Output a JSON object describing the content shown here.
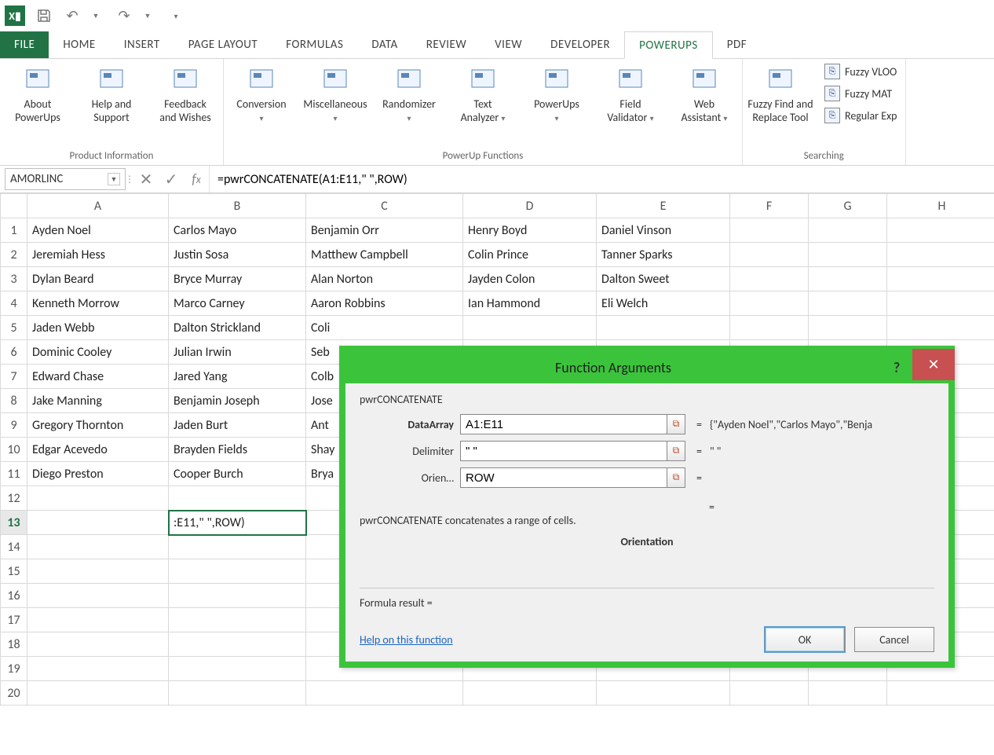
{
  "qat": {
    "app_letter": "X▮"
  },
  "tabs": [
    "FILE",
    "HOME",
    "INSERT",
    "PAGE LAYOUT",
    "FORMULAS",
    "DATA",
    "REVIEW",
    "VIEW",
    "DEVELOPER",
    "POWERUPS",
    "PDF"
  ],
  "active_tab_index": 9,
  "ribbon": {
    "groups": [
      {
        "label": "Product Information",
        "items": [
          {
            "id": "about-powerups-button",
            "line1": "About",
            "line2": "PowerUps",
            "dropdown": false
          },
          {
            "id": "help-support-button",
            "line1": "Help and",
            "line2": "Support",
            "dropdown": false
          },
          {
            "id": "feedback-wishes-button",
            "line1": "Feedback",
            "line2": "and Wishes",
            "dropdown": false
          }
        ]
      },
      {
        "label": "PowerUp Functions",
        "items": [
          {
            "id": "conversion-button",
            "line1": "Conversion",
            "line2": "",
            "dropdown": true
          },
          {
            "id": "miscellaneous-button",
            "line1": "Miscellaneous",
            "line2": "",
            "dropdown": true
          },
          {
            "id": "randomizer-button",
            "line1": "Randomizer",
            "line2": "",
            "dropdown": true
          },
          {
            "id": "text-analyzer-button",
            "line1": "Text",
            "line2": "Analyzer",
            "dropdown": true
          },
          {
            "id": "powerups-button",
            "line1": "PowerUps",
            "line2": "",
            "dropdown": true
          },
          {
            "id": "field-validator-button",
            "line1": "Field",
            "line2": "Validator",
            "dropdown": true
          },
          {
            "id": "web-assistant-button",
            "line1": "Web",
            "line2": "Assistant",
            "dropdown": true
          }
        ]
      },
      {
        "label": "Searching",
        "items": [
          {
            "id": "fuzzy-find-replace-button",
            "line1": "Fuzzy Find and",
            "line2": "Replace Tool",
            "dropdown": false
          }
        ],
        "side": [
          {
            "id": "fuzzy-vlookup-button",
            "label": "Fuzzy VLOO"
          },
          {
            "id": "fuzzy-match-button",
            "label": "Fuzzy MAT"
          },
          {
            "id": "regular-exp-button",
            "label": "Regular Exp"
          }
        ]
      }
    ]
  },
  "namebox": "AMORLINC",
  "formula": "=pwrCONCATENATE(A1:E11,\" \",ROW)",
  "columns": [
    "A",
    "B",
    "C",
    "D",
    "E",
    "F",
    "G",
    "H"
  ],
  "active_col_index": 1,
  "active_row": 13,
  "row_count": 20,
  "cells": {
    "1": [
      "Ayden Noel",
      "Carlos Mayo",
      "Benjamin Orr",
      "Henry Boyd",
      "Daniel Vinson",
      "",
      "",
      ""
    ],
    "2": [
      "Jeremiah Hess",
      "Justin Sosa",
      "Matthew Campbell",
      "Colin Prince",
      "Tanner Sparks",
      "",
      "",
      ""
    ],
    "3": [
      "Dylan Beard",
      "Bryce Murray",
      "Alan Norton",
      "Jayden Colon",
      "Dalton Sweet",
      "",
      "",
      ""
    ],
    "4": [
      "Kenneth Morrow",
      "Marco Carney",
      "Aaron Robbins",
      "Ian Hammond",
      "Eli Welch",
      "",
      "",
      ""
    ],
    "5": [
      "Jaden Webb",
      "Dalton Strickland",
      "Coli",
      "",
      "",
      "",
      "",
      ""
    ],
    "6": [
      "Dominic Cooley",
      "Julian Irwin",
      "Seb",
      "",
      "",
      "",
      "",
      ""
    ],
    "7": [
      "Edward Chase",
      "Jared Yang",
      "Colb",
      "",
      "",
      "",
      "",
      ""
    ],
    "8": [
      "Jake Manning",
      "Benjamin Joseph",
      "Jose",
      "",
      "",
      "",
      "",
      ""
    ],
    "9": [
      "Gregory Thornton",
      "Jaden Burt",
      "Ant",
      "",
      "",
      "",
      "",
      ""
    ],
    "10": [
      "Edgar Acevedo",
      "Brayden Fields",
      "Shay",
      "",
      "",
      "",
      "",
      ""
    ],
    "11": [
      "Diego Preston",
      "Cooper Burch",
      "Brya",
      "",
      "",
      "",
      "",
      ""
    ],
    "13": [
      "",
      ":E11,\" \",ROW)",
      "",
      "",
      "",
      "",
      "",
      ""
    ]
  },
  "dialog": {
    "title": "Function Arguments",
    "func": "pwrCONCATENATE",
    "args": [
      {
        "label": "DataArray",
        "bold": true,
        "value": "A1:E11",
        "preview": "{\"Ayden Noel\",\"Carlos Mayo\",\"Benja"
      },
      {
        "label": "Delimiter",
        "bold": false,
        "value": "\" \"",
        "preview": "\" \""
      },
      {
        "label": "Orien…",
        "bold": false,
        "value": "ROW",
        "preview": ""
      }
    ],
    "overall_eq": "=",
    "description": "pwrCONCATENATE concatenates a range of cells.",
    "param_heading": "Orientation",
    "result_label": "Formula result =",
    "help_link": "Help on this function",
    "ok": "OK",
    "cancel": "Cancel"
  }
}
